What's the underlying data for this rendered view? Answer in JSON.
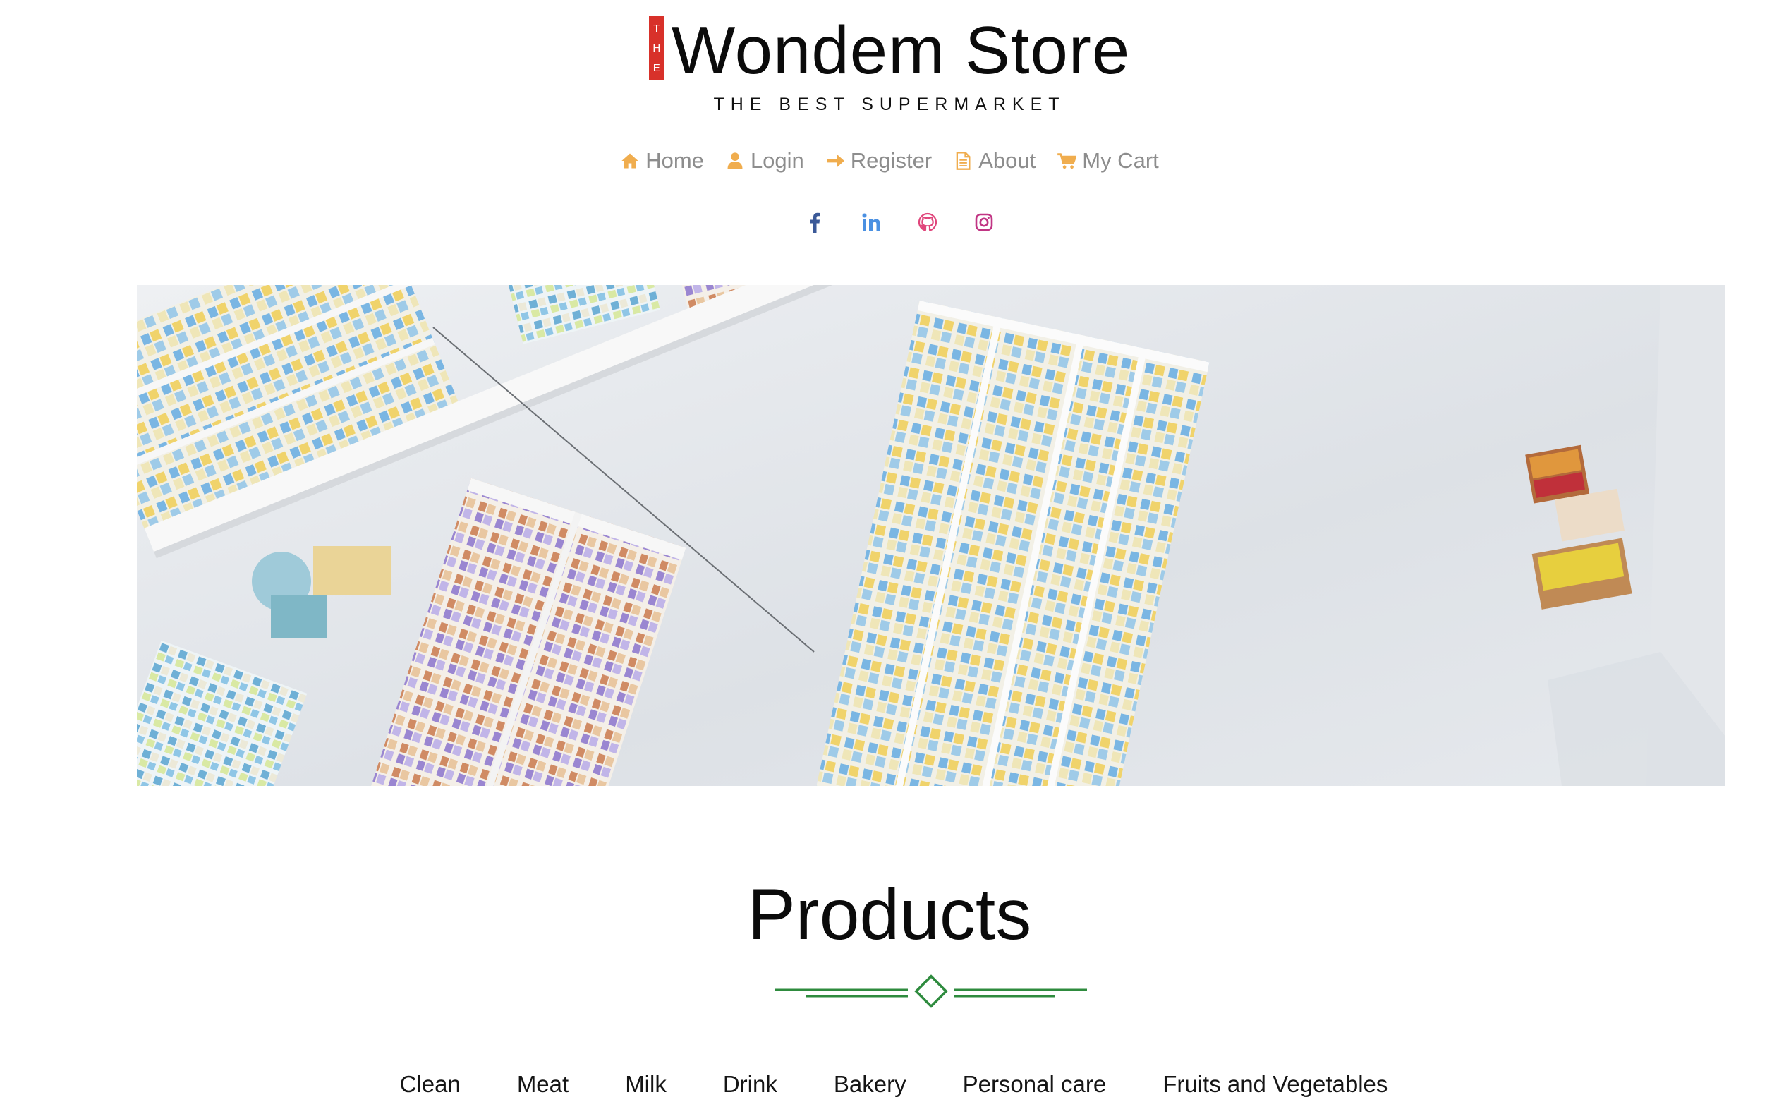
{
  "brand": {
    "badge_letters": [
      "T",
      "H",
      "E"
    ],
    "name": "Wondem Store",
    "tagline": "THE BEST SUPERMARKET"
  },
  "nav": {
    "items": [
      {
        "label": "Home",
        "icon": "home-icon"
      },
      {
        "label": "Login",
        "icon": "user-icon"
      },
      {
        "label": "Register",
        "icon": "arrow-right-icon"
      },
      {
        "label": "About",
        "icon": "document-icon"
      },
      {
        "label": "My Cart",
        "icon": "cart-icon"
      }
    ],
    "icon_color": "#f0ad4e",
    "text_color": "#8d8d8d"
  },
  "social": {
    "items": [
      {
        "name": "facebook",
        "icon": "facebook-icon",
        "color": "#3b5998"
      },
      {
        "name": "linkedin",
        "icon": "linkedin-icon",
        "color": "#4a90e2"
      },
      {
        "name": "github",
        "icon": "github-icon",
        "color": "#e0457b"
      },
      {
        "name": "instagram",
        "icon": "instagram-icon",
        "color": "#c13584"
      }
    ]
  },
  "hero": {
    "alt": "supermarket aisles seen from above"
  },
  "products": {
    "title": "Products",
    "divider_color": "#2e8b3e",
    "categories": [
      "Clean",
      "Meat",
      "Milk",
      "Drink",
      "Bakery",
      "Personal care",
      "Fruits and Vegetables"
    ]
  }
}
